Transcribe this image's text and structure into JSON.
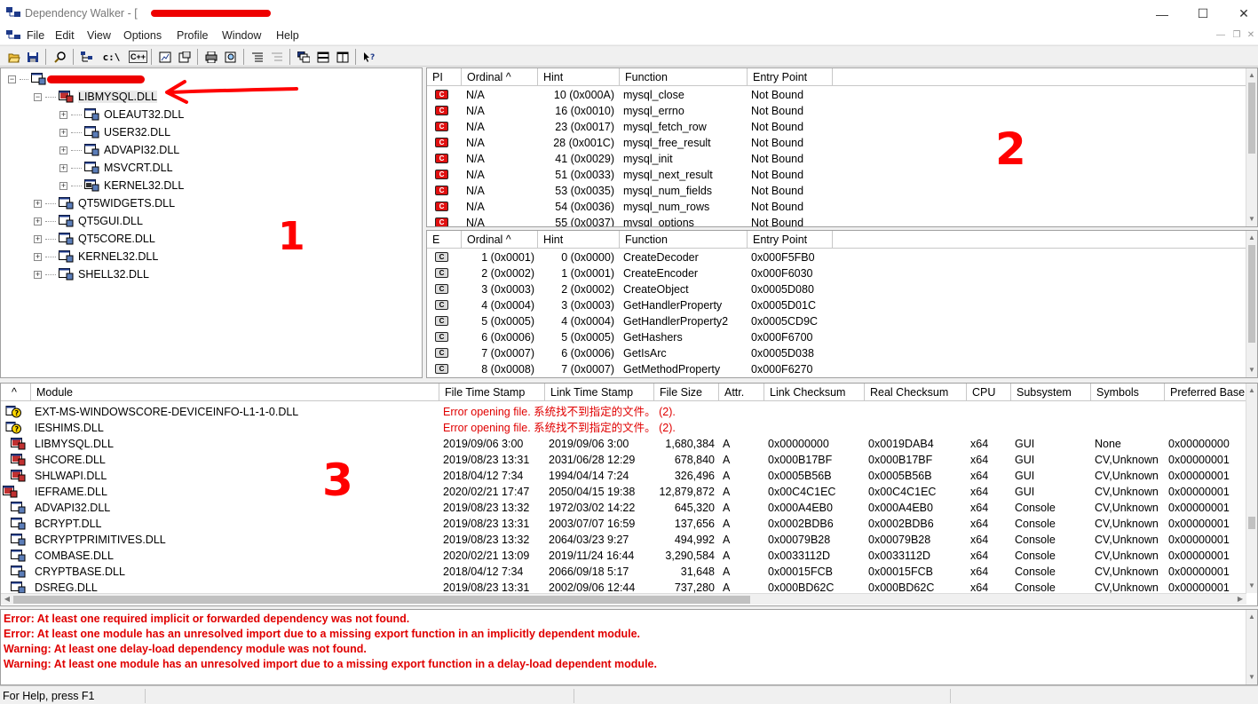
{
  "window": {
    "title": "Dependency Walker - [",
    "controls": {
      "minimize": "—",
      "maximize": "☐",
      "close": "✕"
    }
  },
  "menu": [
    "File",
    "Edit",
    "View",
    "Options",
    "Profile",
    "Window",
    "Help"
  ],
  "mdi_controls": {
    "minimize": "—",
    "restore": "❐",
    "close": "✕"
  },
  "toolbar": {
    "groups": [
      [
        "open-icon",
        "save-icon"
      ],
      [
        "find-icon"
      ],
      [
        "tree-icon",
        "full-path-icon",
        "undecorate-icon"
      ],
      [
        "external-viewer-icon",
        "properties-icon"
      ],
      [
        "print-icon",
        "print-preview-icon"
      ],
      [
        "expand-all-icon",
        "collapse-all-icon"
      ],
      [
        "cascade-icon",
        "tile-horizontal-icon",
        "tile-vertical-icon"
      ],
      [
        "context-help-icon"
      ]
    ],
    "text_buttons": {
      "full_path": "c:\\",
      "undecorate": "C++"
    }
  },
  "tree": {
    "root": "",
    "items": [
      {
        "label": "LIBMYSQL.DLL",
        "level": 1,
        "expander": "−",
        "icon": "red"
      },
      {
        "label": "OLEAUT32.DLL",
        "level": 2,
        "expander": "+",
        "icon": "normal"
      },
      {
        "label": "USER32.DLL",
        "level": 2,
        "expander": "+",
        "icon": "normal"
      },
      {
        "label": "ADVAPI32.DLL",
        "level": 2,
        "expander": "+",
        "icon": "normal"
      },
      {
        "label": "MSVCRT.DLL",
        "level": 2,
        "expander": "+",
        "icon": "normal"
      },
      {
        "label": "KERNEL32.DLL",
        "level": 2,
        "expander": "+",
        "icon": "forward"
      },
      {
        "label": "QT5WIDGETS.DLL",
        "level": 1,
        "expander": "+",
        "icon": "normal"
      },
      {
        "label": "QT5GUI.DLL",
        "level": 1,
        "expander": "+",
        "icon": "normal"
      },
      {
        "label": "QT5CORE.DLL",
        "level": 1,
        "expander": "+",
        "icon": "normal"
      },
      {
        "label": "KERNEL32.DLL",
        "level": 1,
        "expander": "+",
        "icon": "normal"
      },
      {
        "label": "SHELL32.DLL",
        "level": 1,
        "expander": "+",
        "icon": "normal"
      }
    ]
  },
  "imports": {
    "headers": [
      "PI",
      "Ordinal ^",
      "Hint",
      "Function",
      "Entry Point"
    ],
    "rows": [
      [
        "C",
        "N/A",
        "10 (0x000A)",
        "mysql_close",
        "Not Bound"
      ],
      [
        "C",
        "N/A",
        "16 (0x0010)",
        "mysql_errno",
        "Not Bound"
      ],
      [
        "C",
        "N/A",
        "23 (0x0017)",
        "mysql_fetch_row",
        "Not Bound"
      ],
      [
        "C",
        "N/A",
        "28 (0x001C)",
        "mysql_free_result",
        "Not Bound"
      ],
      [
        "C",
        "N/A",
        "41 (0x0029)",
        "mysql_init",
        "Not Bound"
      ],
      [
        "C",
        "N/A",
        "51 (0x0033)",
        "mysql_next_result",
        "Not Bound"
      ],
      [
        "C",
        "N/A",
        "53 (0x0035)",
        "mysql_num_fields",
        "Not Bound"
      ],
      [
        "C",
        "N/A",
        "54 (0x0036)",
        "mysql_num_rows",
        "Not Bound"
      ],
      [
        "C",
        "N/A",
        "55 (0x0037)",
        "mysql_options",
        "Not Bound"
      ]
    ]
  },
  "exports": {
    "headers": [
      "E",
      "Ordinal ^",
      "Hint",
      "Function",
      "Entry Point"
    ],
    "rows": [
      [
        "C",
        "1 (0x0001)",
        "0 (0x0000)",
        "CreateDecoder",
        "0x000F5FB0"
      ],
      [
        "C",
        "2 (0x0002)",
        "1 (0x0001)",
        "CreateEncoder",
        "0x000F6030"
      ],
      [
        "C",
        "3 (0x0003)",
        "2 (0x0002)",
        "CreateObject",
        "0x0005D080"
      ],
      [
        "C",
        "4 (0x0004)",
        "3 (0x0003)",
        "GetHandlerProperty",
        "0x0005D01C"
      ],
      [
        "C",
        "5 (0x0005)",
        "4 (0x0004)",
        "GetHandlerProperty2",
        "0x0005CD9C"
      ],
      [
        "C",
        "6 (0x0006)",
        "5 (0x0005)",
        "GetHashers",
        "0x000F6700"
      ],
      [
        "C",
        "7 (0x0007)",
        "6 (0x0006)",
        "GetIsArc",
        "0x0005D038"
      ],
      [
        "C",
        "8 (0x0008)",
        "7 (0x0007)",
        "GetMethodProperty",
        "0x000F6270"
      ]
    ]
  },
  "modules": {
    "headers": [
      "^",
      "Module",
      "File Time Stamp",
      "Link Time Stamp",
      "File Size",
      "Attr.",
      "Link Checksum",
      "Real Checksum",
      "CPU",
      "Subsystem",
      "Symbols",
      "Preferred Base"
    ],
    "error_rows": [
      {
        "module": "EXT-MS-WINDOWSCORE-DEVICEINFO-L1-1-0.DLL",
        "message": "Error opening file. 系统找不到指定的文件。 (2)."
      },
      {
        "module": "IESHIMS.DLL",
        "message": "Error opening file. 系统找不到指定的文件。 (2)."
      }
    ],
    "rows": [
      [
        "LIBMYSQL.DLL",
        "2019/09/06  3:00",
        "2019/09/06  3:00",
        "1,680,384",
        "A",
        "0x00000000",
        "0x0019DAB4",
        "x64",
        "GUI",
        "None",
        "0x00000000"
      ],
      [
        "SHCORE.DLL",
        "2019/08/23 13:31",
        "2031/06/28 12:29",
        "678,840",
        "A",
        "0x000B17BF",
        "0x000B17BF",
        "x64",
        "GUI",
        "CV,Unknown",
        "0x00000001"
      ],
      [
        "SHLWAPI.DLL",
        "2018/04/12  7:34",
        "1994/04/14  7:24",
        "326,496",
        "A",
        "0x0005B56B",
        "0x0005B56B",
        "x64",
        "GUI",
        "CV,Unknown",
        "0x00000001"
      ],
      [
        "IEFRAME.DLL",
        "2020/02/21 17:47",
        "2050/04/15 19:38",
        "12,879,872",
        "A",
        "0x00C4C1EC",
        "0x00C4C1EC",
        "x64",
        "GUI",
        "CV,Unknown",
        "0x00000001"
      ],
      [
        "ADVAPI32.DLL",
        "2019/08/23 13:32",
        "1972/03/02 14:22",
        "645,320",
        "A",
        "0x000A4EB0",
        "0x000A4EB0",
        "x64",
        "Console",
        "CV,Unknown",
        "0x00000001"
      ],
      [
        "BCRYPT.DLL",
        "2019/08/23 13:31",
        "2003/07/07 16:59",
        "137,656",
        "A",
        "0x0002BDB6",
        "0x0002BDB6",
        "x64",
        "Console",
        "CV,Unknown",
        "0x00000001"
      ],
      [
        "BCRYPTPRIMITIVES.DLL",
        "2019/08/23 13:32",
        "2064/03/23  9:27",
        "494,992",
        "A",
        "0x00079B28",
        "0x00079B28",
        "x64",
        "Console",
        "CV,Unknown",
        "0x00000001"
      ],
      [
        "COMBASE.DLL",
        "2020/02/21 13:09",
        "2019/11/24 16:44",
        "3,290,584",
        "A",
        "0x0033112D",
        "0x0033112D",
        "x64",
        "Console",
        "CV,Unknown",
        "0x00000001"
      ],
      [
        "CRYPTBASE.DLL",
        "2018/04/12  7:34",
        "2066/09/18  5:17",
        "31,648",
        "A",
        "0x00015FCB",
        "0x00015FCB",
        "x64",
        "Console",
        "CV,Unknown",
        "0x00000001"
      ],
      [
        "DSREG.DLL",
        "2019/08/23 13:31",
        "2002/09/06 12:44",
        "737,280",
        "A",
        "0x000BD62C",
        "0x000BD62C",
        "x64",
        "Console",
        "CV,Unknown",
        "0x00000001"
      ]
    ]
  },
  "log": [
    "Error: At least one required implicit or forwarded dependency was not found.",
    "Error: At least one module has an unresolved import due to a missing export function in an implicitly dependent module.",
    "Warning: At least one delay-load dependency module was not found.",
    "Warning: At least one module has an unresolved import due to a missing export function in a delay-load dependent module."
  ],
  "status": "For Help, press F1",
  "annotations": [
    "1",
    "2",
    "3"
  ],
  "colors": {
    "error_text": "#e00000",
    "annotation": "#ff0000",
    "import_icon": "#e01010"
  }
}
